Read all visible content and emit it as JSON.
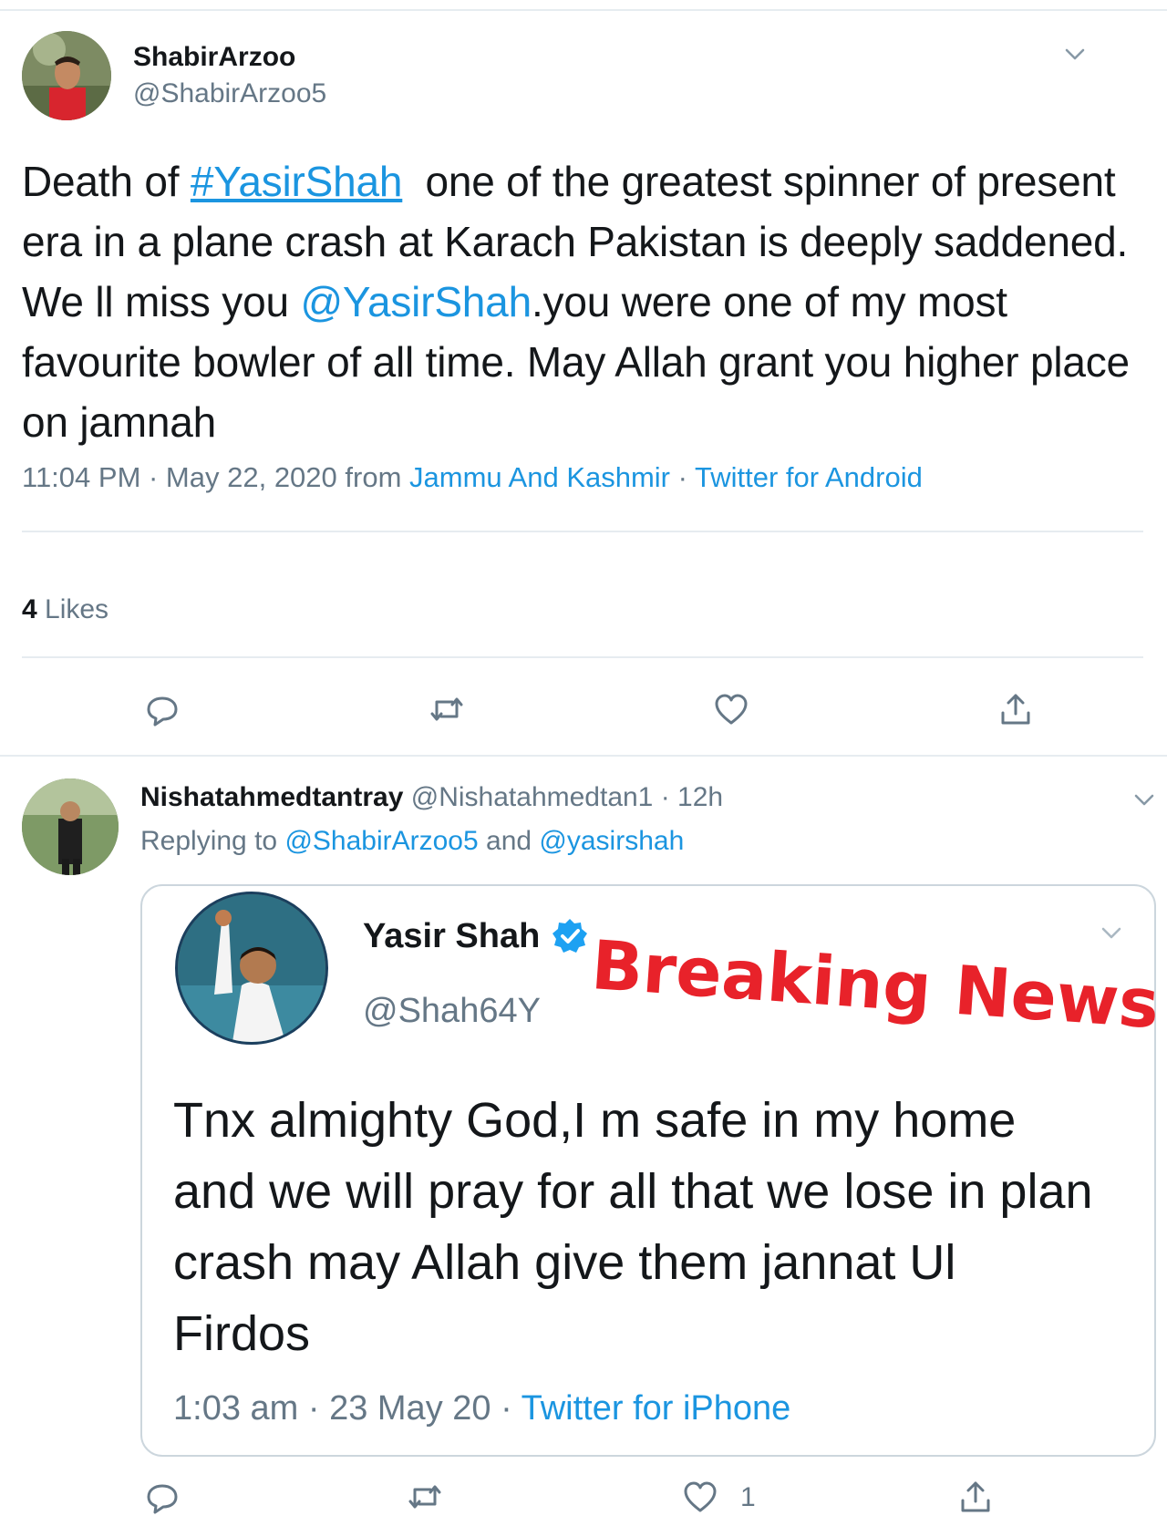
{
  "tweet": {
    "author_name": "ShabirArzoo",
    "author_handle": "@ShabirArzoo5",
    "text_before": "Death of ",
    "hashtag": "#YasirShah",
    "text_middle": "  one of the greatest spinner of present era in a plane crash at Karach Pakistan is deeply saddened. We ll miss you ",
    "mention": "@YasirShah",
    "text_after": ".you were one of my most favourite bowler of all time. May Allah grant you higher place on jamnah",
    "timestamp": "11:04 PM · May 22, 2020 from ",
    "location": "Jammu And Kashmir",
    "separator": " · ",
    "source": "Twitter for Android",
    "likes_count": "4",
    "likes_label": " Likes"
  },
  "reply": {
    "author_name": "Nishatahmedtantray",
    "author_handle": "@Nishatahmedtan1",
    "time_ago": " · 12h",
    "replying_prefix": "Replying to ",
    "replying_user1": "@ShabirArzoo5",
    "replying_and": " and ",
    "replying_user2": "@yasirshah",
    "like_count": "1"
  },
  "quoted": {
    "author_name": "Yasir Shah",
    "author_handle": "@Shah64Y",
    "overlay": "Breaking News",
    "text": "Tnx almighty God,I m safe in my home and we will pray for all that we lose in plan crash may Allah give them jannat Ul Firdos",
    "timestamp": "1:03 am · 23 May 20 · ",
    "source": "Twitter for iPhone"
  },
  "icons": [
    "chevron-down-icon",
    "reply-icon",
    "retweet-icon",
    "like-icon",
    "share-icon",
    "verified-badge-icon"
  ],
  "colors": {
    "link": "#1b95e0",
    "muted": "#657786",
    "text": "#14171a",
    "breaking": "#e8222a",
    "divider": "#e6ecf0"
  }
}
